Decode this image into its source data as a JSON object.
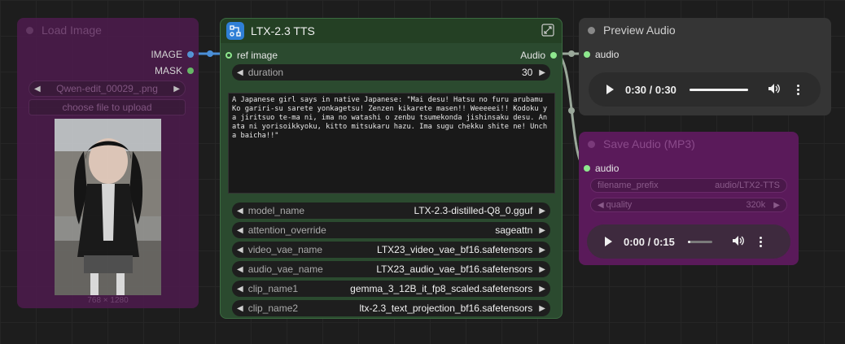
{
  "colors": {
    "image_wire": "#4a8fd8",
    "audio_wire": "#9aa89a",
    "audio_slot": "#8ee88e",
    "image_slot": "#5aa0e6"
  },
  "load_image": {
    "title": "Load Image",
    "outputs": [
      "IMAGE",
      "MASK"
    ],
    "file": "Qwen-edit_00029_.png",
    "upload_label": "choose file to upload",
    "image_size": "768 × 1280"
  },
  "tts": {
    "title": "LTX-2.3 TTS",
    "input_label": "ref image",
    "output_label": "Audio",
    "duration": {
      "label": "duration",
      "value": "30"
    },
    "prompt": "A Japanese girl says in native Japanese: \"Mai desu! Hatsu no furu arubamu Ko gariri-su sarete yonkagetsu! Zenzen kikarete masen!! Weeeeei!! Kodoku ya jiritsuo te-ma ni, ima no watashi o zenbu tsumekonda jishinsaku desu. Anata ni yorisoikkyoku, kitto mitsukaru hazu. Ima sugu chekku shite ne! Uncha baicha!!\"",
    "widgets": [
      {
        "label": "model_name",
        "value": "LTX-2.3-distilled-Q8_0.gguf"
      },
      {
        "label": "attention_override",
        "value": "sageattn"
      },
      {
        "label": "video_vae_name",
        "value": "LTX23_video_vae_bf16.safetensors"
      },
      {
        "label": "audio_vae_name",
        "value": "LTX23_audio_vae_bf16.safetensors"
      },
      {
        "label": "clip_name1",
        "value": "gemma_3_12B_it_fp8_scaled.safetensors"
      },
      {
        "label": "clip_name2",
        "value": "ltx-2.3_text_projection_bf16.safetensors"
      }
    ]
  },
  "preview_audio": {
    "title": "Preview Audio",
    "input_label": "audio",
    "time": "0:30 / 0:30",
    "progress": 1.0
  },
  "save_audio": {
    "title": "Save Audio (MP3)",
    "input_label": "audio",
    "filename_prefix": {
      "label": "filename_prefix",
      "value": "audio/LTX2-TTS"
    },
    "quality": {
      "label": "quality",
      "value": "320k"
    },
    "time": "0:00 / 0:15",
    "progress": 0.06
  }
}
